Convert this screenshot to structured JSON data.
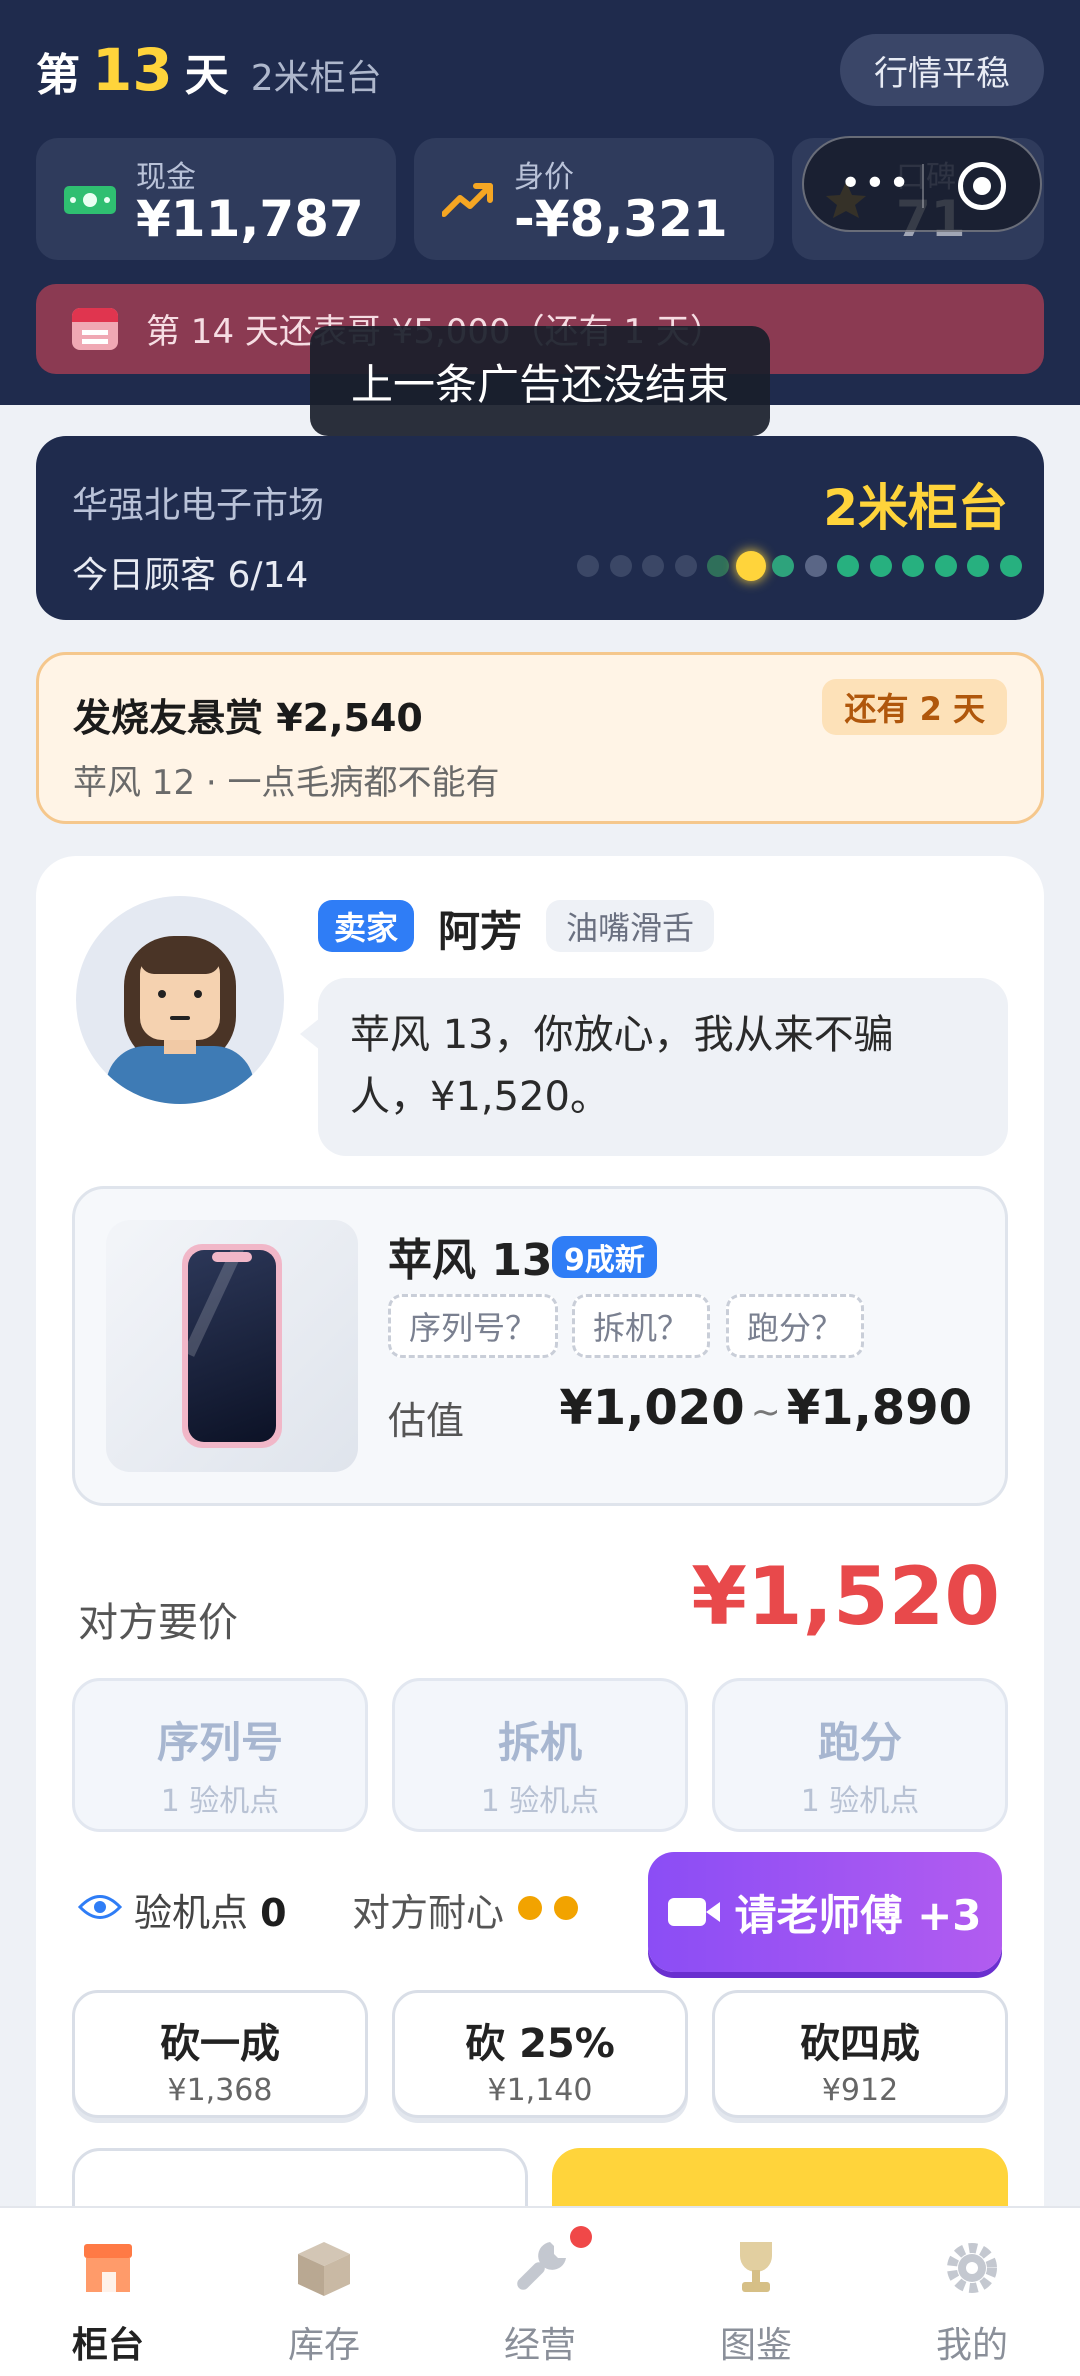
{
  "header": {
    "day_prefix": "第",
    "day_number": "13",
    "day_suffix": "天",
    "level_name": "2米柜台",
    "market_status": "行情平稳"
  },
  "stats": {
    "cash": {
      "label": "现金",
      "value": "¥11,787",
      "icon": "cash-icon"
    },
    "worth": {
      "label": "身价",
      "value": "-¥8,321",
      "icon": "trend-up-icon"
    },
    "reputation": {
      "label": "口碑",
      "value": "71",
      "icon": "star-icon"
    }
  },
  "debt_notice": {
    "text": "第 14 天还表哥 ¥5,000（还有 1 天）",
    "icon": "calendar-icon"
  },
  "toast": "上一条广告还没结束",
  "market": {
    "name": "华强北电子市场",
    "booth": "2米柜台",
    "customers": "今日顾客 6/14",
    "progress": {
      "done": 6,
      "total": 14,
      "current": 6
    }
  },
  "bounty": {
    "title": "发烧友悬赏 ¥2,540",
    "days_left": "还有 2 天",
    "desc": "苹风 12 · 一点毛病都不能有"
  },
  "seller": {
    "tag": "卖家",
    "name": "阿芳",
    "trait": "油嘴滑舌",
    "line1": "苹风 13，你放心，我从来不骗",
    "line2": "人，¥1,520。"
  },
  "item": {
    "name": "苹风 13",
    "condition": "9成新",
    "checks": [
      "序列号？",
      "拆机？",
      "跑分？"
    ],
    "estimate_label": "估值",
    "estimate_low": "¥1,020",
    "estimate_sep": "~",
    "estimate_high": "¥1,890"
  },
  "offer": {
    "label": "对方要价",
    "price": "¥1,520"
  },
  "inspections": [
    {
      "title": "序列号",
      "cost": "1 验机点"
    },
    {
      "title": "拆机",
      "cost": "1 验机点"
    },
    {
      "title": "跑分",
      "cost": "1 验机点"
    }
  ],
  "inspect_points": {
    "label": "验机点",
    "value": "0"
  },
  "patience": {
    "label": "对方耐心",
    "level": 2
  },
  "expert_button": "请老师傅 +3",
  "haggle": [
    {
      "title": "砍一成",
      "price": "¥1,368"
    },
    {
      "title": "砍 25%",
      "price": "¥1,140"
    },
    {
      "title": "砍四成",
      "price": "¥912"
    }
  ],
  "tabs": [
    {
      "label": "柜台",
      "icon": "shop-icon",
      "active": true
    },
    {
      "label": "库存",
      "icon": "box-icon",
      "active": false
    },
    {
      "label": "经营",
      "icon": "wrench-icon",
      "active": false,
      "badge": true
    },
    {
      "label": "图鉴",
      "icon": "trophy-icon",
      "active": false
    },
    {
      "label": "我的",
      "icon": "gear-icon",
      "active": false
    }
  ],
  "colors": {
    "header_bg": "#1f2b4d",
    "accent_yellow": "#ffd43b",
    "price_red": "#e8494b",
    "seller_blue": "#2f7df6",
    "expert_purple": "#8b4df5"
  }
}
